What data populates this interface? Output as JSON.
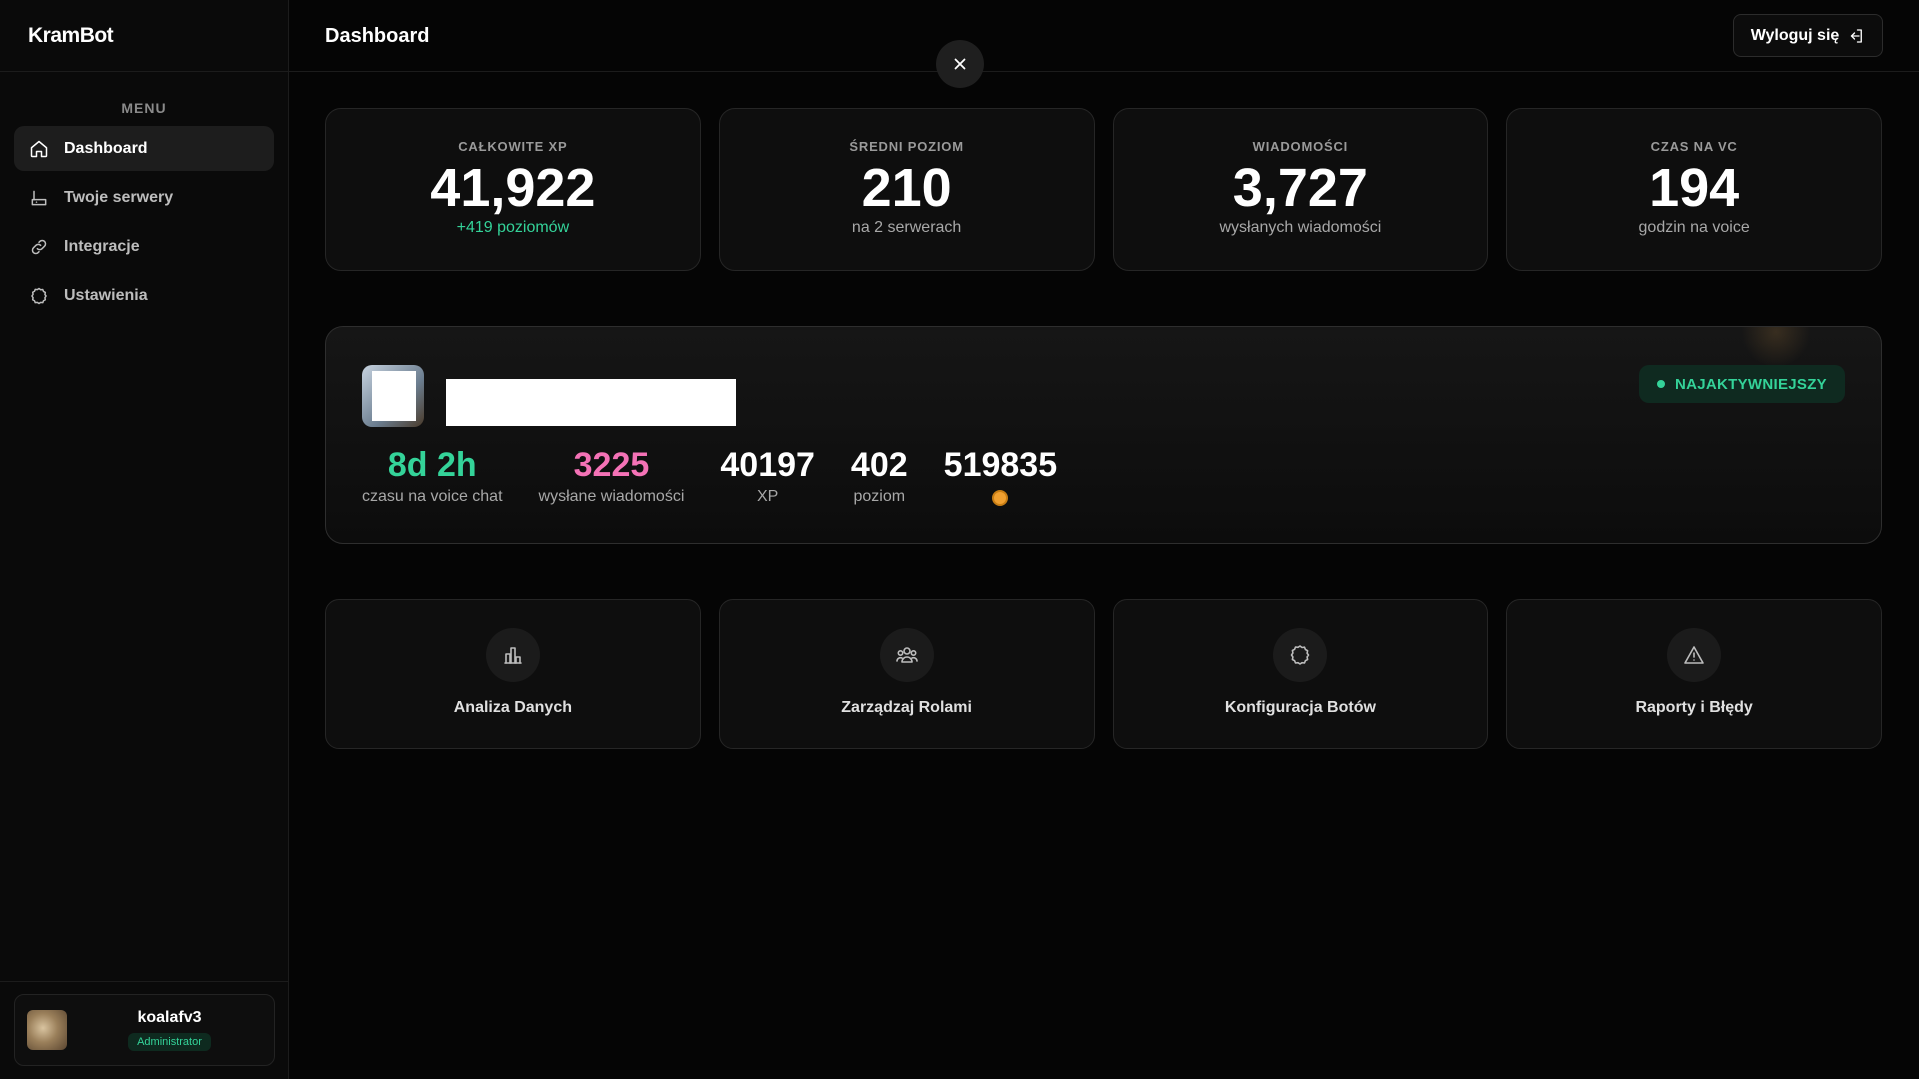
{
  "brand": "KramBot",
  "sidebar": {
    "menu_label": "MENU",
    "items": [
      {
        "label": "Dashboard",
        "icon": "home-icon",
        "active": true
      },
      {
        "label": "Twoje serwery",
        "icon": "server-icon",
        "active": false
      },
      {
        "label": "Integracje",
        "icon": "link-icon",
        "active": false
      },
      {
        "label": "Ustawienia",
        "icon": "gear-icon",
        "active": false
      }
    ]
  },
  "user": {
    "name": "koalafv3",
    "role": "Administrator"
  },
  "header": {
    "title": "Dashboard",
    "logout_label": "Wyloguj się"
  },
  "stats": [
    {
      "label": "CAŁKOWITE XP",
      "value": "41,922",
      "sub": "+419 poziomów",
      "sub_color": "#34d399"
    },
    {
      "label": "ŚREDNI POZIOM",
      "value": "210",
      "sub": "na 2 serwerach"
    },
    {
      "label": "WIADOMOŚCI",
      "value": "3,727",
      "sub": "wysłanych wiadomości"
    },
    {
      "label": "CZAS NA VC",
      "value": "194",
      "sub": "godzin na voice"
    }
  ],
  "top_user": {
    "badge": "NAJAKTYWNIEJSZY",
    "metrics": [
      {
        "value": "8d 2h",
        "label": "czasu na voice chat",
        "color": "#34d399"
      },
      {
        "value": "3225",
        "label": "wysłane wiadomości",
        "color": "#f472b6"
      },
      {
        "value": "40197",
        "label": "XP"
      },
      {
        "value": "402",
        "label": "poziom"
      },
      {
        "value": "519835",
        "label": "",
        "icon": "coin-icon"
      }
    ]
  },
  "actions": [
    {
      "label": "Analiza Danych",
      "icon": "bar-chart-icon"
    },
    {
      "label": "Zarządzaj Rolami",
      "icon": "users-icon"
    },
    {
      "label": "Konfiguracja Botów",
      "icon": "gear-icon"
    },
    {
      "label": "Raporty i Błędy",
      "icon": "warning-icon"
    }
  ],
  "colors": {
    "accent_green": "#34d399",
    "accent_pink": "#f472b6",
    "background": "#050505"
  }
}
